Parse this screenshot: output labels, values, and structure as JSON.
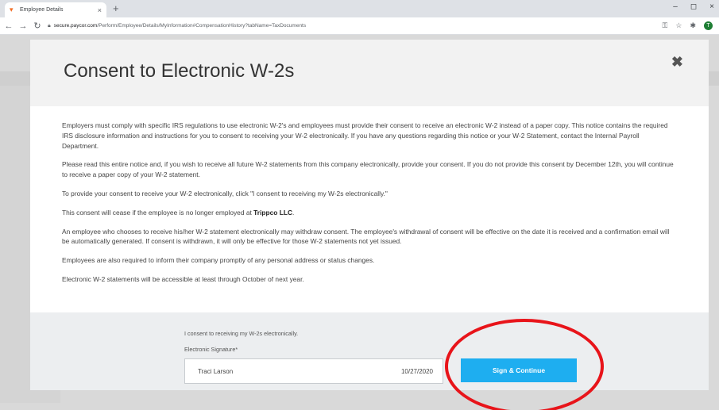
{
  "browser": {
    "tab_title": "Employee Details",
    "tab_close": "×",
    "new_tab": "+",
    "url_host": "secure.paycor.com",
    "url_path": "/Perform/Employee/Details/MyInformation#CompensationHistory?tabName=TaxDocuments",
    "window_controls": {
      "minimize": "–",
      "maximize": "◻",
      "close": "×"
    },
    "profile_initial": "T"
  },
  "modal": {
    "title": "Consent to Electronic W-2s",
    "close": "✖",
    "paragraphs": [
      "Employers must comply with specific IRS regulations to use electronic W-2's and employees must provide their consent to receive an electronic W-2 instead of a paper copy. This notice contains the required IRS disclosure information and instructions for you to consent to receiving your W-2 electronically. If you have any questions regarding this notice or your W-2 Statement, contact the Internal Payroll Department.",
      "Please read this entire notice and, if you wish to receive all future W-2 statements from this company electronically, provide your consent. If you do not provide this consent by December 12th, you will continue to receive a paper copy of your W-2 statement.",
      "To provide your consent to receive your W-2 electronically, click \"I consent to receiving my W-2s electronically.\""
    ],
    "cease_prefix": "This consent will cease if the employee is no longer employed at ",
    "company_name": "Trippco LLC",
    "cease_suffix": ".",
    "paragraphs_after": [
      "An employee who chooses to receive his/her W-2 statement electronically may withdraw consent. The employee's withdrawal of consent will be effective on the date it is received and a confirmation email will be automatically generated. If consent is withdrawn, it will only be effective for those W-2 statements not yet issued.",
      "Employees are also required to inform their company promptly of any personal address or status changes.",
      "Electronic W-2 statements will be accessible at least through October of next year."
    ]
  },
  "footer": {
    "consent_text": "I consent to receiving my W-2s electronically.",
    "signature_label": "Electronic Signature*",
    "signature_name": "Traci Larson",
    "signature_date": "10/27/2020",
    "sign_button_label": "Sign & Continue"
  },
  "colors": {
    "accent": "#1eaef0",
    "annotation": "#e8141a"
  }
}
